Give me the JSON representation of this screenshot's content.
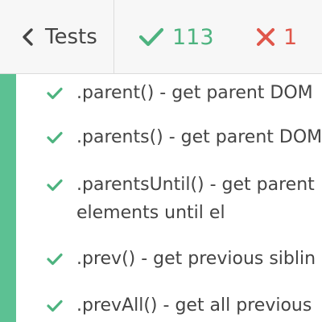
{
  "header": {
    "back_label": "Tests",
    "passed_count": "113",
    "failed_count": "1",
    "passed_color": "#4db37f",
    "failed_color": "#e0564a"
  },
  "tests": [
    {
      "title": ".parent() - get parent DOM",
      "status": "passed"
    },
    {
      "title": ".parents() - get parent DOM",
      "status": "passed"
    },
    {
      "title": ".parentsUntil() - get parent",
      "title_line2": "elements until el",
      "status": "passed"
    },
    {
      "title": ".prev() - get previous siblin",
      "status": "passed"
    },
    {
      "title": ".prevAll() - get all previous",
      "status": "passed"
    }
  ]
}
